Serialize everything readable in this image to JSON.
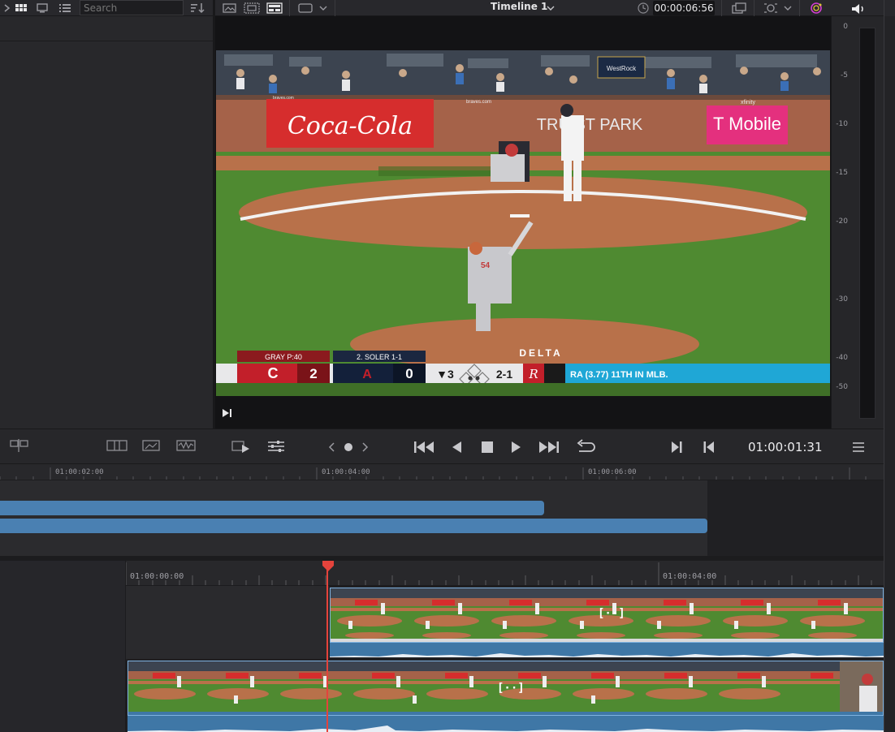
{
  "toolbar": {
    "search_placeholder": "Search",
    "timeline_name": "Timeline 1",
    "source_timecode": "00:00:06:56"
  },
  "viewer": {
    "scorebug": {
      "away_header": "GRAY  P:40",
      "away_score": "2",
      "home_header": "2. SOLER  1-1",
      "home_score": "0",
      "inning": "▼3",
      "count": "2-1",
      "ticker": "RA (3.77) 11TH IN MLB.",
      "sponsor": "DELTA"
    },
    "signage": {
      "coke": "Coca-Cola",
      "truist": "TRUIST PARK",
      "tmobile": "T Mobile",
      "westrock": "WestRock",
      "braves_com": "braves.com",
      "xfinity": "xfinity"
    }
  },
  "audio_meter": {
    "ticks": [
      "0",
      "-5",
      "-10",
      "-15",
      "-20",
      "-30",
      "-40",
      "-50"
    ]
  },
  "transport": {
    "current_timecode": "01:00:01:31"
  },
  "mini_timeline": {
    "ruler": [
      "01:00:02:00",
      "01:00:04:00",
      "01:00:06:00"
    ]
  },
  "timeline": {
    "ruler": [
      "01:00:00:00",
      "01:00:04:00"
    ]
  },
  "colors": {
    "accent_blue": "#4a80b2",
    "playhead_red": "#e4433c",
    "panel_bg": "#28282b"
  },
  "icons": [
    "grid-view-icon",
    "list-view-icon",
    "sort-icon",
    "audio-icon",
    "play-icon",
    "stop-icon",
    "loop-icon",
    "menu-icon"
  ]
}
